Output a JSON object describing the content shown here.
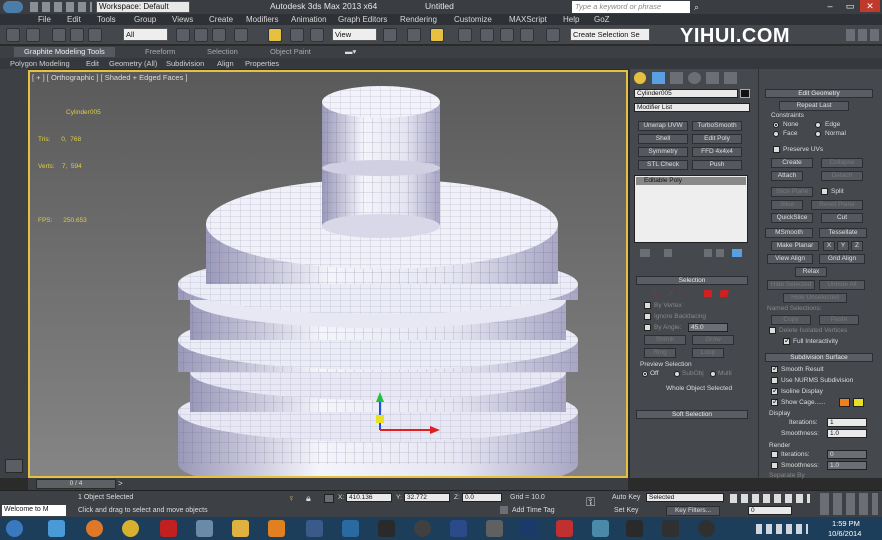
{
  "titlebar": {
    "workspace": "Workspace: Default",
    "app_title": "Autodesk 3ds Max  2013 x64",
    "doc_title": "Untitled",
    "search_placeholder": "Type a keyword or phrase"
  },
  "menu": [
    "File",
    "Edit",
    "Tools",
    "Group",
    "Views",
    "Create",
    "Modifiers",
    "Animation",
    "Graph Editors",
    "Rendering",
    "Customize",
    "MAXScript",
    "Help",
    "GoZ"
  ],
  "toolbar": {
    "filter_select": "All",
    "view_select": "View",
    "selection_set": "Create Selection Se"
  },
  "watermark": "YIHUI.COM",
  "ribbon": {
    "tabs": [
      "Graphite Modeling Tools",
      "Freeform",
      "Selection",
      "Object Paint"
    ],
    "subtabs": [
      "Polygon Modeling",
      "Edit",
      "Geometry (All)",
      "Subdivision",
      "Align",
      "Properties"
    ]
  },
  "viewport": {
    "label": "[ + ] [ Orthographic ] [ Shaded + Edged Faces ]",
    "stats_name": "Cylinder005",
    "stats_tris_label": "Tris:",
    "stats_tris": "0,  768",
    "stats_verts_label": "Verts:",
    "stats_verts": "7,  594",
    "stats_fps_label": "FPS:",
    "stats_fps": "250.653"
  },
  "command_panel": {
    "object_name": "Cylinder005",
    "modifier_list": "Modifier List",
    "buttons": [
      "Unwrap UVW",
      "TurboSmooth",
      "Shell",
      "Edit Poly",
      "Symmetry",
      "FFD 4x4x4",
      "STL Check",
      "Push"
    ],
    "stack_item": "Editable Poly",
    "selection_rollout": "Selection",
    "by_vertex": "By Vertex",
    "ignore_backfacing": "Ignore Backfacing",
    "by_angle": "By Angle:",
    "by_angle_val": "45.0",
    "shrink": "Shrink",
    "grow": "Grow",
    "ring": "Ring",
    "loop": "Loop",
    "preview_selection": "Preview Selection",
    "off": "Off",
    "subobj": "SubObj",
    "multi": "Multi",
    "whole_object_selected": "Whole Object Selected",
    "soft_selection": "Soft Selection"
  },
  "right_panel": {
    "edit_geometry": "Edit Geometry",
    "repeat_last": "Repeat Last",
    "constraints": "Constraints",
    "none": "None",
    "edge": "Edge",
    "face": "Face",
    "normal": "Normal",
    "preserve_uvs": "Preserve UVs",
    "create": "Create",
    "collapse": "Collapse",
    "attach": "Attach",
    "detach": "Detach",
    "slice_plane": "Slice Plane",
    "split": "Split",
    "slice": "Slice",
    "reset_plane": "Reset Plane",
    "quickslice": "QuickSlice",
    "cut": "Cut",
    "msmooth": "MSmooth",
    "tessellate": "Tessellate",
    "make_planar": "Make Planar",
    "x": "X",
    "y": "Y",
    "z": "Z",
    "view_align": "View Align",
    "grid_align": "Grid Align",
    "relax": "Relax",
    "hide_selected": "Hide Selected",
    "unhide_all": "Unhide All",
    "hide_unselected": "Hide Unselected",
    "named_selections": "Named Selections:",
    "copy": "Copy",
    "paste": "Paste",
    "delete_isolated": "Delete Isolated Vertices",
    "full_interactivity": "Full Interactivity",
    "subdivision_surface": "Subdivision Surface",
    "smooth_result": "Smooth Result",
    "use_nurms": "Use NURMS Subdivision",
    "isoline_display": "Isoline Display",
    "show_cage": "Show Cage......",
    "display": "Display",
    "iterations_label": "Iterations:",
    "iterations": "1",
    "smoothness_label": "Smoothness:",
    "smoothness": "1.0",
    "render": "Render",
    "render_iterations": "0",
    "render_smoothness": "1.0",
    "separate_by": "Separate By",
    "cage_color_1": "#f08020",
    "cage_color_2": "#e8e020"
  },
  "timeline": {
    "frame": "0 / 4"
  },
  "status": {
    "welcome": "Welcome to M",
    "objects_selected": "1 Object Selected",
    "prompt": "Click and drag to select and move objects",
    "x_label": "X:",
    "x": "410.136",
    "y_label": "Y:",
    "y": "32.772",
    "z_label": "Z:",
    "z": "0.0",
    "grid": "Grid = 10.0",
    "auto_key": "Auto Key",
    "set_key": "Set Key",
    "key_mode": "Selected",
    "key_filters": "Key Filters...",
    "add_time_tag": "Add Time Tag",
    "frame_field": "0"
  },
  "taskbar": {
    "time": "1:59 PM",
    "date": "10/6/2014"
  }
}
